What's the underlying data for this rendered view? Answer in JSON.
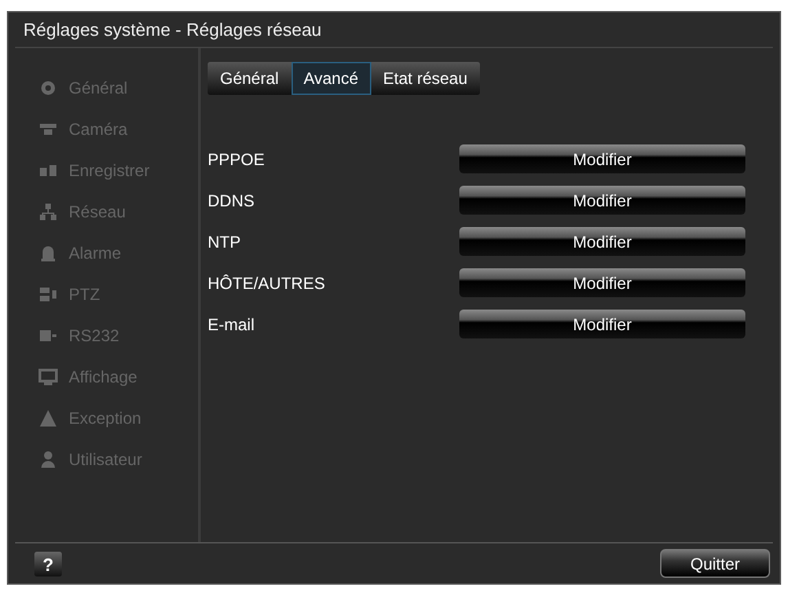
{
  "window": {
    "title": "Réglages système - Réglages réseau"
  },
  "sidebar": {
    "items": [
      {
        "label": "Général",
        "selected": false
      },
      {
        "label": "Caméra",
        "selected": false
      },
      {
        "label": "Enregistrer",
        "selected": false
      },
      {
        "label": "Réseau",
        "selected": false
      },
      {
        "label": "Alarme",
        "selected": false
      },
      {
        "label": "PTZ",
        "selected": false
      },
      {
        "label": "RS232",
        "selected": false
      },
      {
        "label": "Affichage",
        "selected": false
      },
      {
        "label": "Exception",
        "selected": false
      },
      {
        "label": "Utilisateur",
        "selected": false
      }
    ]
  },
  "tabs": [
    {
      "label": "Général",
      "selected": false
    },
    {
      "label": "Avancé",
      "selected": true
    },
    {
      "label": "Etat réseau",
      "selected": false
    }
  ],
  "settings": [
    {
      "label": "PPPOE",
      "button": "Modifier"
    },
    {
      "label": "DDNS",
      "button": "Modifier"
    },
    {
      "label": "NTP",
      "button": "Modifier"
    },
    {
      "label": "HÔTE/AUTRES",
      "button": "Modifier"
    },
    {
      "label": "E-mail",
      "button": "Modifier"
    }
  ],
  "footer": {
    "help": "?",
    "exit_button": "Quitter"
  }
}
